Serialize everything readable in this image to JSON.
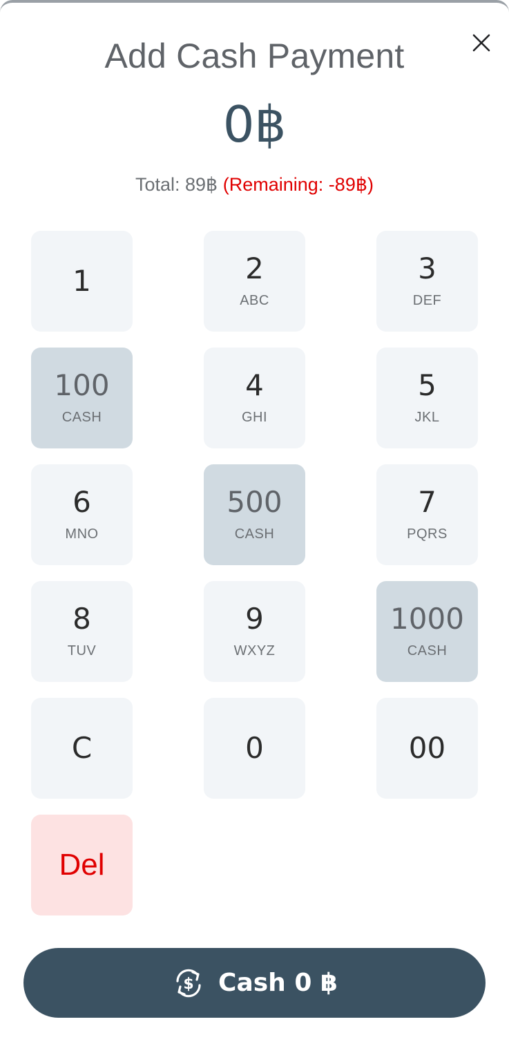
{
  "dialog": {
    "title": "Add Cash Payment",
    "amount": "0฿",
    "total": "Total: 89฿",
    "remaining": "(Remaining: -89฿)"
  },
  "keypad": {
    "keys": [
      {
        "digit": "1",
        "letters": ""
      },
      {
        "digit": "2",
        "letters": "ABC"
      },
      {
        "digit": "3",
        "letters": "DEF"
      },
      {
        "digit": "100",
        "letters": "CASH"
      },
      {
        "digit": "4",
        "letters": "GHI"
      },
      {
        "digit": "5",
        "letters": "JKL"
      },
      {
        "digit": "6",
        "letters": "MNO"
      },
      {
        "digit": "500",
        "letters": "CASH"
      },
      {
        "digit": "7",
        "letters": "PQRS"
      },
      {
        "digit": "8",
        "letters": "TUV"
      },
      {
        "digit": "9",
        "letters": "WXYZ"
      },
      {
        "digit": "1000",
        "letters": "CASH"
      },
      {
        "digit": "C",
        "letters": ""
      },
      {
        "digit": "0",
        "letters": ""
      },
      {
        "digit": "00",
        "letters": ""
      },
      {
        "digit": "Del",
        "letters": ""
      }
    ]
  },
  "pay_button": {
    "label": "Cash 0 ฿",
    "icon": "currency-exchange-icon"
  },
  "icons": {
    "close": "close-icon"
  },
  "colors": {
    "accent": "#3b5262",
    "key_bg": "#f2f5f8",
    "cash_key_bg": "#d0dae1",
    "delete_bg": "#fde2e2",
    "remaining": "#e00000"
  }
}
